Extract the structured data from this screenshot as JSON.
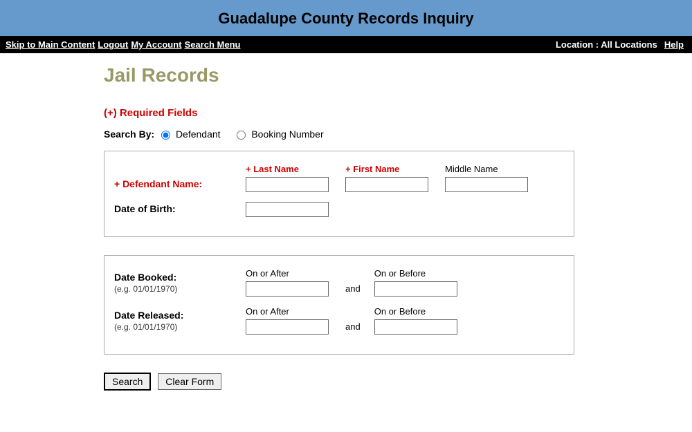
{
  "banner": {
    "title": "Guadalupe County Records Inquiry"
  },
  "nav": {
    "left": [
      "Skip to Main Content",
      "Logout",
      "My Account",
      "Search Menu"
    ],
    "location_label": "Location : All Locations",
    "help": "Help"
  },
  "page": {
    "heading": "Jail Records",
    "required_note": "(+) Required Fields",
    "search_by_label": "Search By:",
    "search_by_options": {
      "defendant": "Defendant",
      "booking": "Booking Number"
    }
  },
  "defendant_box": {
    "name_label": "+ Defendant Name:",
    "last": "+ Last Name",
    "first": "+ First Name",
    "middle": "Middle Name",
    "dob_label": "Date of Birth:"
  },
  "date_box": {
    "booked_label": "Date Booked:",
    "released_label": "Date Released:",
    "example": "(e.g. 01/01/1970)",
    "on_after": "On or After",
    "on_before": "On or Before",
    "and": "and"
  },
  "buttons": {
    "search": "Search",
    "clear": "Clear Form"
  }
}
